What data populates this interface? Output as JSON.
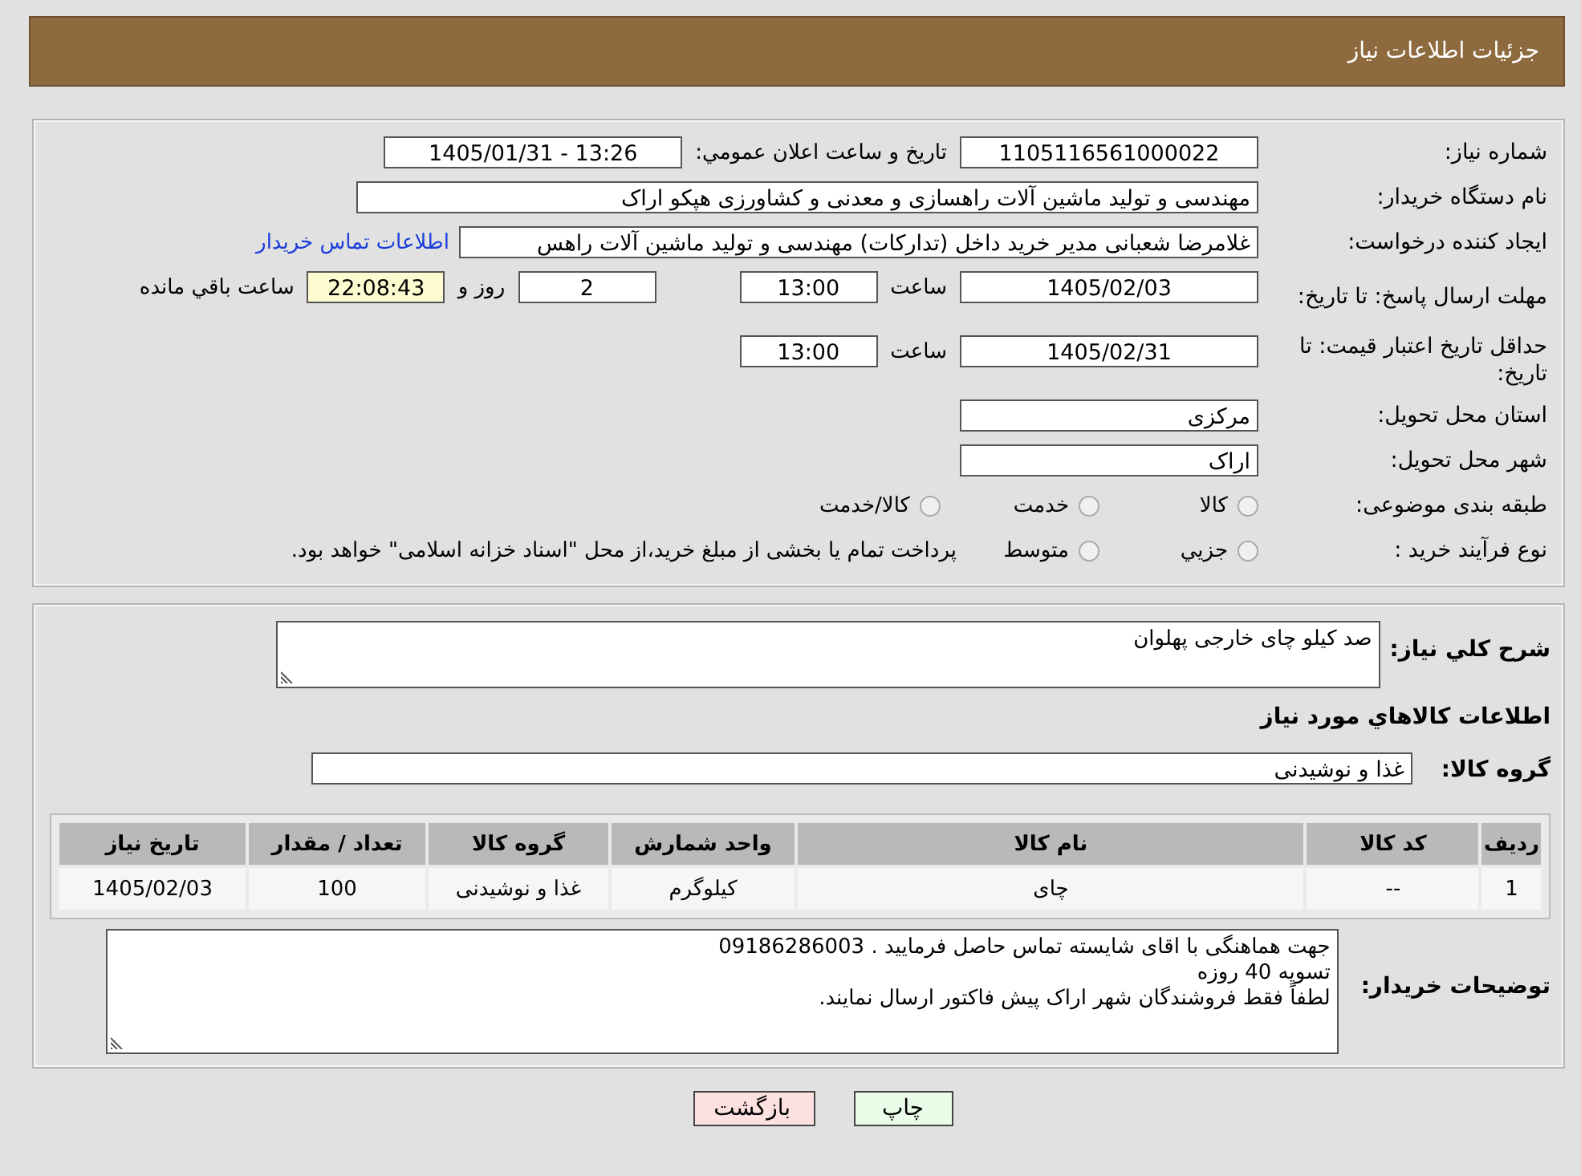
{
  "header": {
    "title": "جزئیات اطلاعات نیاز"
  },
  "details": {
    "need_number": {
      "label": "شماره نیاز:",
      "value": "1105116561000022"
    },
    "announce": {
      "label": "تاریخ و ساعت اعلان عمومي:",
      "value": "1405/01/31 - 13:26"
    },
    "buyer": {
      "label": "نام دستگاه خریدار:",
      "value": "مهندسی و تولید ماشین آلات راهسازی و معدنی و کشاورزی هپکو اراک"
    },
    "requester": {
      "label": "ایجاد کننده درخواست:",
      "value": "غلامرضا شعبانی مدیر خرید داخل (تدارکات) مهندسی و تولید ماشین آلات راهس",
      "link": "اطلاعات تماس خریدار"
    },
    "deadline": {
      "label": "مهلت ارسال پاسخ: تا تاریخ:",
      "date": "1405/02/03",
      "time_label": "ساعت",
      "time": "13:00",
      "days": "2",
      "days_label": "روز و",
      "remaining": "22:08:43",
      "remaining_label": "ساعت باقي مانده"
    },
    "validity": {
      "label": "حداقل تاریخ اعتبار قیمت: تا تاریخ:",
      "date": "1405/02/31",
      "time_label": "ساعت",
      "time": "13:00"
    },
    "province": {
      "label": "استان محل تحویل:",
      "value": "مرکزی"
    },
    "city": {
      "label": "شهر محل تحویل:",
      "value": "اراک"
    },
    "category": {
      "label": "طبقه بندی موضوعی:",
      "options": [
        {
          "label": "کالا",
          "selected": false
        },
        {
          "label": "خدمت",
          "selected": false
        },
        {
          "label": "کالا/خدمت",
          "selected": false
        }
      ]
    },
    "process": {
      "label": "نوع فرآیند خرید :",
      "options": [
        {
          "label": "جزيي",
          "selected": false
        },
        {
          "label": "متوسط",
          "selected": false
        }
      ],
      "note": "پرداخت تمام یا بخشی از مبلغ خرید،از محل \"اسناد خزانه اسلامی\" خواهد بود."
    }
  },
  "summary": {
    "label": "شرح کلي نیاز:",
    "value": "صد کیلو چای خارجی پهلوان"
  },
  "goods_heading": "اطلاعات کالاهاي مورد نیاز",
  "goods_group": {
    "label": "گروه کالا:",
    "value": "غذا و نوشیدنی"
  },
  "table": {
    "columns": [
      "ردیف",
      "کد کالا",
      "نام کالا",
      "واحد شمارش",
      "گروه کالا",
      "تعداد / مقدار",
      "تاریخ نیاز"
    ],
    "rows": [
      [
        "1",
        "--",
        "چای",
        "کیلوگرم",
        "غذا و نوشیدنی",
        "100",
        "1405/02/03"
      ]
    ]
  },
  "buyer_notes": {
    "label": "توضیحات خریدار:",
    "lines": [
      "جهت هماهنگی با  اقای شایسته تماس حاصل فرمایید .  09186286003",
      "تسویه 40 روزه",
      "لطفاً فقط فروشندگان شهر اراک پیش فاکتور ارسال نمایند."
    ]
  },
  "buttons": [
    {
      "label": "چاپ",
      "kind": "print"
    },
    {
      "label": "بازگشت",
      "kind": "back"
    }
  ]
}
